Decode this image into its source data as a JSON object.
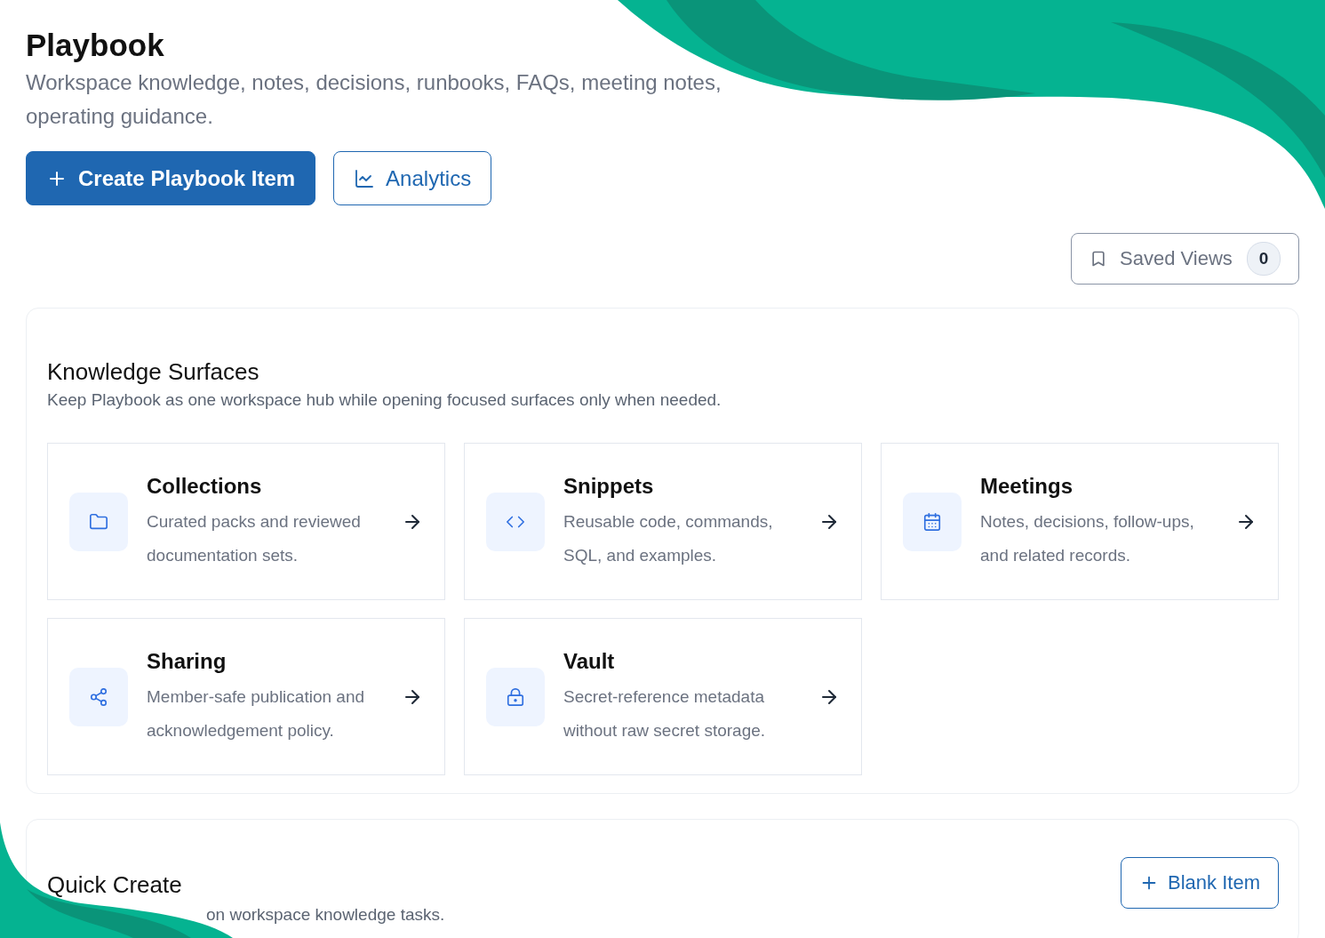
{
  "header": {
    "title": "Playbook",
    "subtitle_lines": [
      "Workspace knowledge, notes, decisions, runbooks, FAQs, meeting notes,",
      "operating guidance."
    ]
  },
  "actions": [
    {
      "label": "Create Playbook Item",
      "kind": "primary"
    },
    {
      "label": "Analytics",
      "kind": "secondary"
    }
  ],
  "saved_views": {
    "label": "Saved Views",
    "count": "0"
  },
  "knowledge_surfaces": {
    "title": "Knowledge Surfaces",
    "subtitle": "Keep Playbook as one workspace hub while opening focused surfaces only when needed.",
    "cards": [
      {
        "title": "Collections",
        "description": "Curated packs and reviewed documentation sets."
      },
      {
        "title": "Snippets",
        "description": "Reusable code, commands, SQL, and examples."
      },
      {
        "title": "Meetings",
        "description": "Notes, decisions, follow-ups, and related records."
      },
      {
        "title": "Sharing",
        "description": "Member-safe publication and acknowledgement policy."
      },
      {
        "title": "Vault",
        "description": "Secret-reference metadata without raw secret storage."
      }
    ]
  },
  "quick_create": {
    "title": "Quick Create",
    "subtitle": "on workspace knowledge tasks.",
    "button": "Blank Item"
  }
}
